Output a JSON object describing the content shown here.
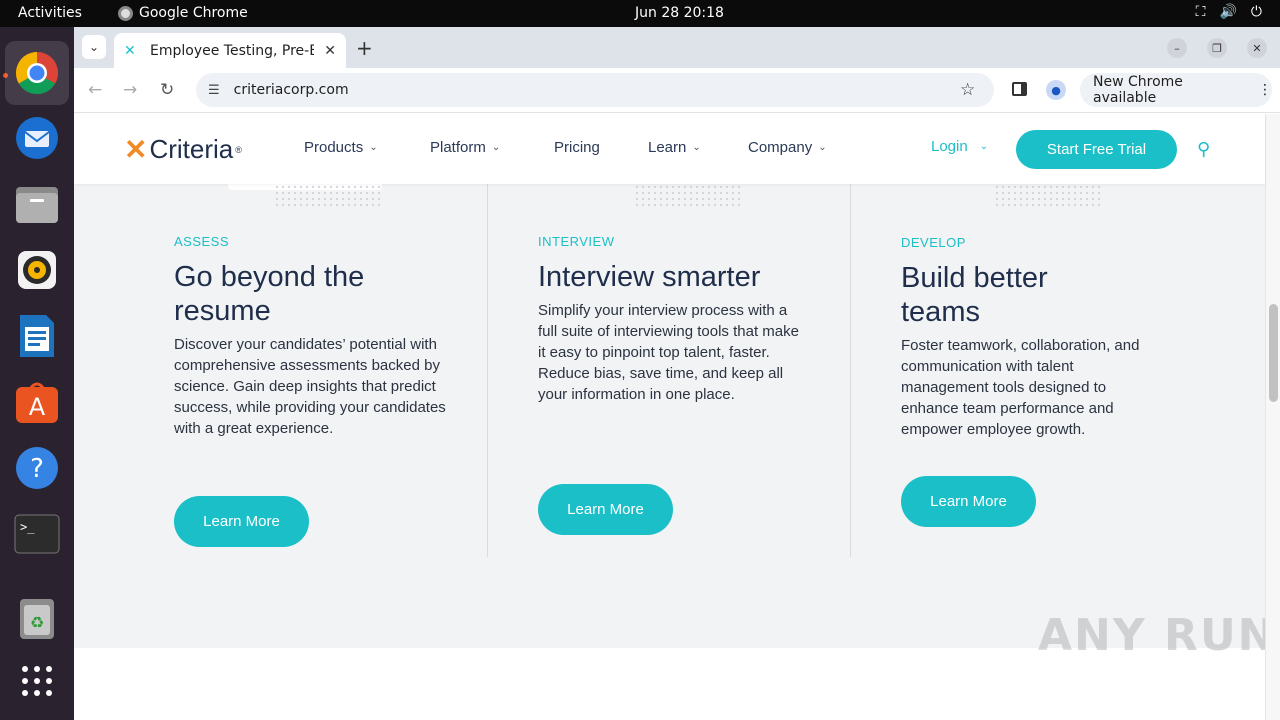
{
  "system": {
    "activities": "Activities",
    "app_name": "Google Chrome",
    "clock": "Jun 28  20:18",
    "tray_icons": [
      "network-icon",
      "volume-icon",
      "power-icon"
    ]
  },
  "browser": {
    "tab_title": "Employee Testing, Pre-E",
    "url": "criteriacorp.com",
    "new_chrome_label": "New Chrome available",
    "window_controls": [
      "minimize",
      "restore",
      "close"
    ]
  },
  "site": {
    "logo_text": "Criteria",
    "nav": [
      {
        "label": "Products",
        "dropdown": true
      },
      {
        "label": "Platform",
        "dropdown": true
      },
      {
        "label": "Pricing",
        "dropdown": false
      },
      {
        "label": "Learn",
        "dropdown": true
      },
      {
        "label": "Company",
        "dropdown": true
      }
    ],
    "login_label": "Login",
    "trial_label": "Start Free Trial",
    "accent_color": "#1bbfc7",
    "columns": [
      {
        "eyebrow": "ASSESS",
        "heading": "Go beyond the resume",
        "body": "Discover your candidates’ potential with comprehensive assessments backed by science. Gain deep insights that predict success, while providing your candidates with a great experience.",
        "button": "Learn More"
      },
      {
        "eyebrow": "INTERVIEW",
        "heading": "Interview smarter",
        "body": "Simplify your interview process with a full suite of interviewing tools that make it easy to pinpoint top talent, faster. Reduce bias, save time, and keep all your information in one place.",
        "button": "Learn More"
      },
      {
        "eyebrow": "DEVELOP",
        "heading": "Build better teams",
        "body": "Foster teamwork, collaboration, and communication with talent management tools designed to enhance team performance and empower employee growth.",
        "button": "Learn More"
      }
    ]
  },
  "watermark": "ANY RUN"
}
